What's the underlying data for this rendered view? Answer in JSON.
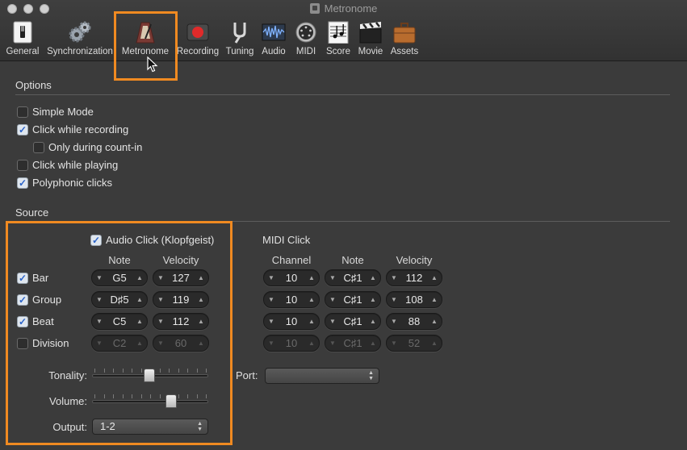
{
  "window": {
    "title": "Metronome"
  },
  "toolbar": {
    "items": [
      {
        "label": "General",
        "icon": "general-switch-icon"
      },
      {
        "label": "Synchronization",
        "icon": "gears-icon"
      },
      {
        "label": "Metronome",
        "icon": "metronome-icon"
      },
      {
        "label": "Recording",
        "icon": "record-button-icon"
      },
      {
        "label": "Tuning",
        "icon": "tuning-fork-icon"
      },
      {
        "label": "Audio",
        "icon": "waveform-icon"
      },
      {
        "label": "MIDI",
        "icon": "midi-port-icon"
      },
      {
        "label": "Score",
        "icon": "sheet-music-icon"
      },
      {
        "label": "Movie",
        "icon": "clapperboard-icon"
      },
      {
        "label": "Assets",
        "icon": "briefcase-icon"
      }
    ],
    "selected": "Metronome"
  },
  "options": {
    "title": "Options",
    "items": [
      {
        "label": "Simple Mode",
        "checked": false
      },
      {
        "label": "Click while recording",
        "checked": true
      },
      {
        "label": "Only during count-in",
        "checked": false
      },
      {
        "label": "Click while playing",
        "checked": false
      },
      {
        "label": "Polyphonic clicks",
        "checked": true
      }
    ]
  },
  "source": {
    "title": "Source",
    "audio_click": {
      "label": "Audio Click (Klopfgeist)",
      "checked": true,
      "note_header": "Note",
      "velocity_header": "Velocity"
    },
    "midi_click": {
      "label": "MIDI Click",
      "channel_header": "Channel",
      "note_header": "Note",
      "velocity_header": "Velocity"
    },
    "rows": [
      {
        "label": "Bar",
        "checked": true,
        "audio_note": "G5",
        "audio_velocity": "127",
        "midi_channel": "10",
        "midi_note": "C♯1",
        "midi_velocity": "112"
      },
      {
        "label": "Group",
        "checked": true,
        "audio_note": "D♯5",
        "audio_velocity": "119",
        "midi_channel": "10",
        "midi_note": "C♯1",
        "midi_velocity": "108"
      },
      {
        "label": "Beat",
        "checked": true,
        "audio_note": "C5",
        "audio_velocity": "112",
        "midi_channel": "10",
        "midi_note": "C♯1",
        "midi_velocity": "88"
      },
      {
        "label": "Division",
        "checked": false,
        "audio_note": "C2",
        "audio_velocity": "60",
        "midi_channel": "10",
        "midi_note": "C♯1",
        "midi_velocity": "52"
      }
    ],
    "tonality": {
      "label": "Tonality:",
      "level": 0.49
    },
    "volume": {
      "label": "Volume:",
      "level": 0.68
    },
    "output": {
      "label": "Output:",
      "value": "1-2"
    },
    "port": {
      "label": "Port:",
      "value": ""
    }
  },
  "colors": {
    "highlight": "#f08a21",
    "background": "#3b3b3b",
    "checkbox_check": "#2a63c9"
  }
}
